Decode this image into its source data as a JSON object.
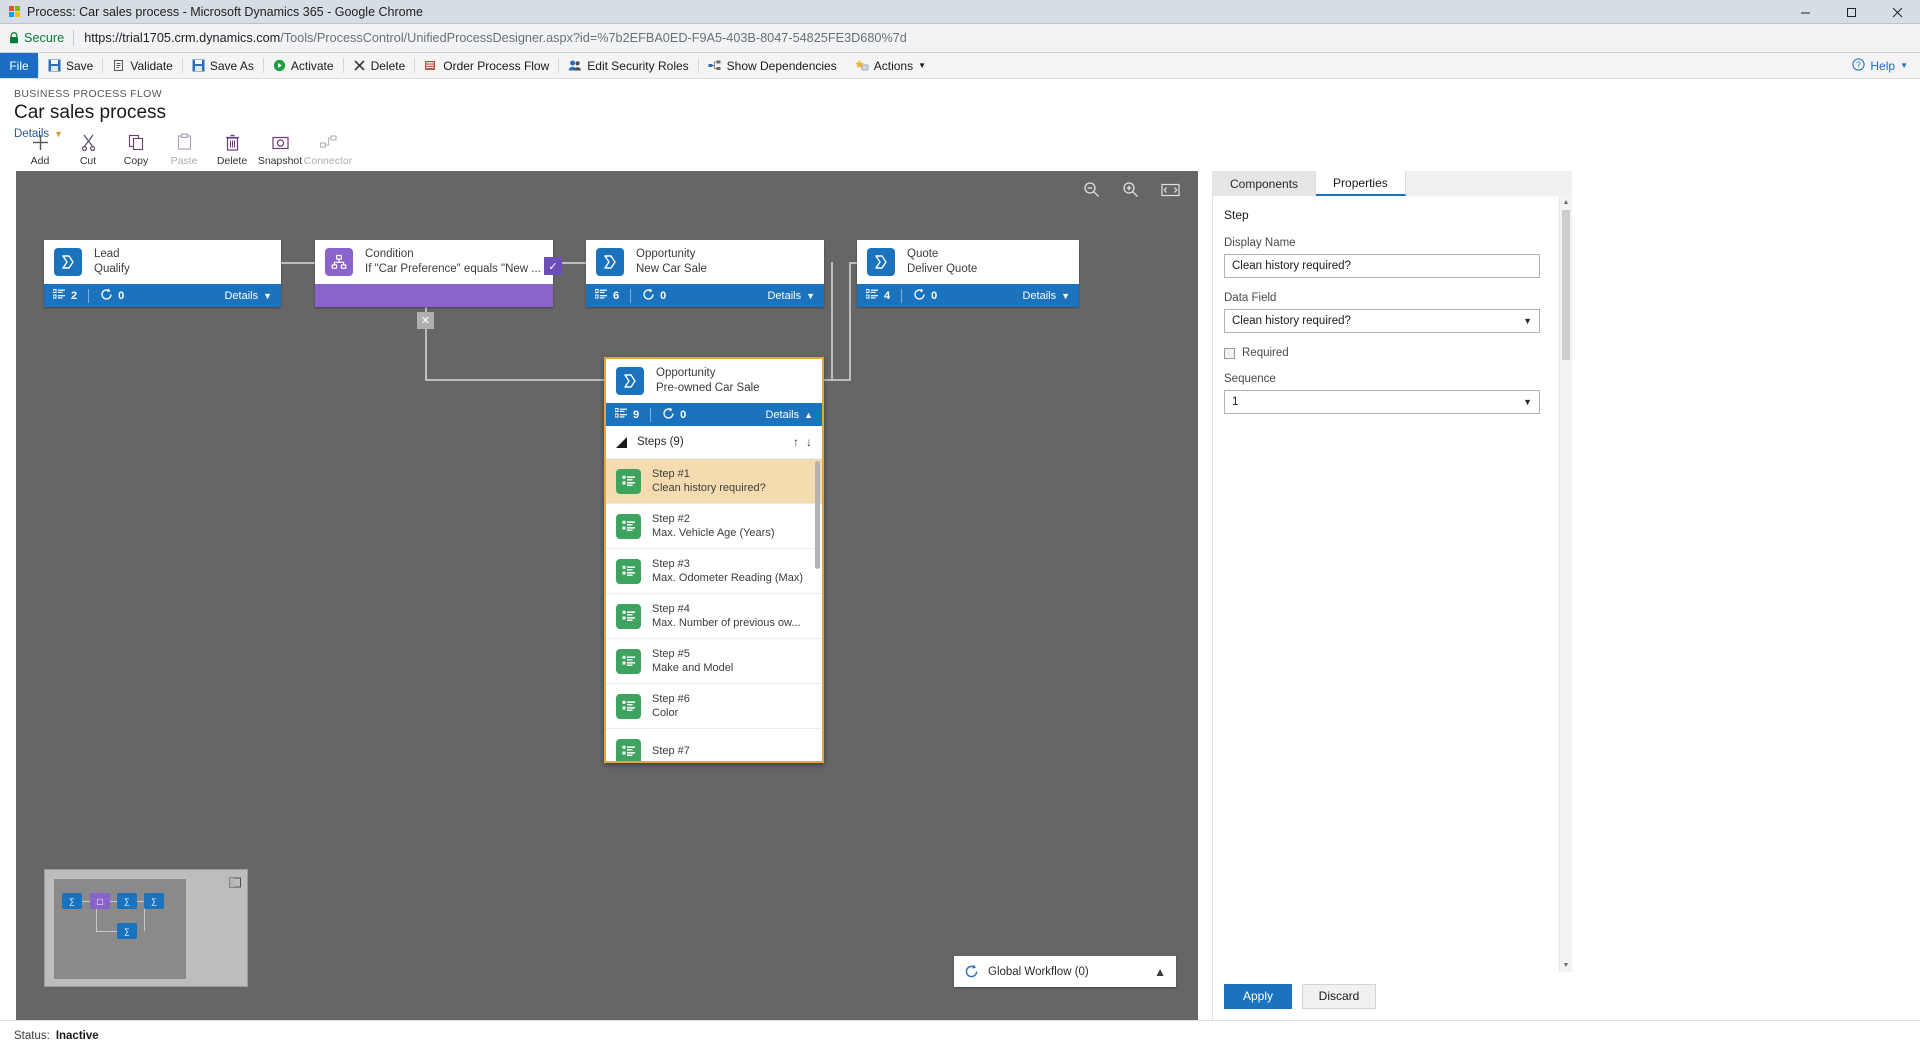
{
  "browser": {
    "window_title": "Process: Car sales process - Microsoft Dynamics 365 - Google Chrome",
    "secure_label": "Secure",
    "url_host": "https://trial1705.crm.dynamics.com",
    "url_path": "/Tools/ProcessControl/UnifiedProcessDesigner.aspx?id=%7b2EFBA0ED-F9A5-403B-8047-54825FE3D680%7d",
    "minimize": "minimize-icon",
    "maximize": "maximize-icon",
    "close": "close-icon"
  },
  "commandbar": {
    "file": "File",
    "items": [
      {
        "label": "Save",
        "icon": "save-icon"
      },
      {
        "label": "Validate",
        "icon": "validate-icon"
      },
      {
        "label": "Save As",
        "icon": "save-as-icon"
      },
      {
        "label": "Activate",
        "icon": "activate-icon"
      },
      {
        "label": "Delete",
        "icon": "delete-icon"
      },
      {
        "label": "Order Process Flow",
        "icon": "order-process-flow-icon"
      },
      {
        "label": "Edit Security Roles",
        "icon": "edit-security-roles-icon"
      },
      {
        "label": "Show Dependencies",
        "icon": "show-dependencies-icon"
      },
      {
        "label": "Actions",
        "icon": "actions-icon"
      }
    ],
    "help": "Help"
  },
  "header": {
    "eyebrow": "BUSINESS PROCESS FLOW",
    "title": "Car sales process",
    "details_link": "Details"
  },
  "designer_toolbar": [
    {
      "label": "Add",
      "icon": "plus-icon",
      "disabled": false
    },
    {
      "label": "Cut",
      "icon": "scissors-icon",
      "disabled": false
    },
    {
      "label": "Copy",
      "icon": "copy-icon",
      "disabled": false
    },
    {
      "label": "Paste",
      "icon": "paste-icon",
      "disabled": true
    },
    {
      "label": "Delete",
      "icon": "trash-icon",
      "disabled": false
    },
    {
      "label": "Snapshot",
      "icon": "camera-icon",
      "disabled": false
    },
    {
      "label": "Connector",
      "icon": "connector-icon",
      "disabled": true
    }
  ],
  "canvas": {
    "zoom_out": "zoom-out-icon",
    "zoom_in": "zoom-in-icon",
    "fit_to_screen": "fit-to-screen-icon",
    "stages": [
      {
        "entity": "Lead",
        "name": "Qualify",
        "steps": "2",
        "workflows": "0",
        "details": "Details"
      },
      {
        "entity": "Condition",
        "name": "If \"Car Preference\" equals \"New ...",
        "details": ""
      },
      {
        "entity": "Opportunity",
        "name": "New Car Sale",
        "steps": "6",
        "workflows": "0",
        "details": "Details"
      },
      {
        "entity": "Quote",
        "name": "Deliver Quote",
        "steps": "4",
        "workflows": "0",
        "details": "Details"
      }
    ],
    "selected_stage": {
      "entity": "Opportunity",
      "name": "Pre-owned Car Sale",
      "steps_count": "9",
      "workflows_count": "0",
      "details": "Details",
      "steps_header": "Steps (9)",
      "move_up_icon": "arrow-up-icon",
      "move_down_icon": "arrow-down-icon",
      "steps": [
        {
          "num": "Step #1",
          "name": "Clean history required?",
          "active": true
        },
        {
          "num": "Step #2",
          "name": "Max. Vehicle Age (Years)",
          "active": false
        },
        {
          "num": "Step #3",
          "name": "Max. Odometer Reading (Max)",
          "active": false
        },
        {
          "num": "Step #4",
          "name": "Max. Number of previous ow...",
          "active": false
        },
        {
          "num": "Step #5",
          "name": "Make and Model",
          "active": false
        },
        {
          "num": "Step #6",
          "name": "Color",
          "active": false
        },
        {
          "num": "Step #7",
          "name": "",
          "active": false
        }
      ]
    },
    "global_workflow": {
      "label": "Global Workflow (0)",
      "icon": "workflow-icon",
      "caret": "chevron-up-icon"
    },
    "minimap": {
      "expand_icon": "expand-minimap-icon"
    }
  },
  "properties_panel": {
    "tabs": [
      {
        "label": "Components",
        "active": false
      },
      {
        "label": "Properties",
        "active": true
      }
    ],
    "section_title": "Step",
    "display_name_label": "Display Name",
    "display_name_value": "Clean history required?",
    "data_field_label": "Data Field",
    "data_field_value": "Clean history required?",
    "required_label": "Required",
    "required_checked": false,
    "sequence_label": "Sequence",
    "sequence_value": "1",
    "apply_button": "Apply",
    "discard_button": "Discard"
  },
  "statusbar": {
    "label": "Status:",
    "value": "Inactive"
  }
}
